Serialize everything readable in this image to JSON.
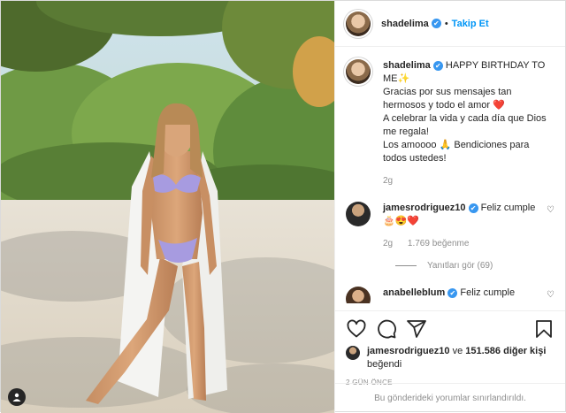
{
  "header": {
    "username": "shadelima",
    "verified_glyph": "✔",
    "separator": "•",
    "follow_label": "Takip Et"
  },
  "caption": {
    "username": "shadelima",
    "first_line": "HAPPY BIRTHDAY TO ME",
    "emoji": "✨",
    "text": "Gracias por sus mensajes tan hermosos y todo el amor ❤️\nA celebrar la vida y cada día que Dios me regala!\nLos amoooo 🙏 Bendiciones para todos ustedes!",
    "time": "2g"
  },
  "comments": [
    {
      "username": "jamesrodriguez10",
      "text": "Feliz cumple",
      "emoji": "🎂😍❤️",
      "time": "2g",
      "likes": "1.769 beğenme",
      "replies": "Yanıtları gör (69)"
    },
    {
      "username": "anabelleblum",
      "text": "Feliz cumple"
    }
  ],
  "actions": {
    "icons": [
      "heart-icon",
      "comment-icon",
      "share-icon",
      "bookmark-icon"
    ]
  },
  "likes": {
    "user": "jamesrodriguez10",
    "middle": " ve ",
    "count": "151.586 diğer kişi",
    "suffix": "beğendi"
  },
  "time_ago": "2 GÜN ÖNCE",
  "comments_limited": "Bu gönderideki yorumlar sınırlandırıldı.",
  "colors": {
    "accent": "#0095f6",
    "verified": "#3897f0",
    "heart": "#ed4956",
    "muted": "#8e8e8e"
  }
}
